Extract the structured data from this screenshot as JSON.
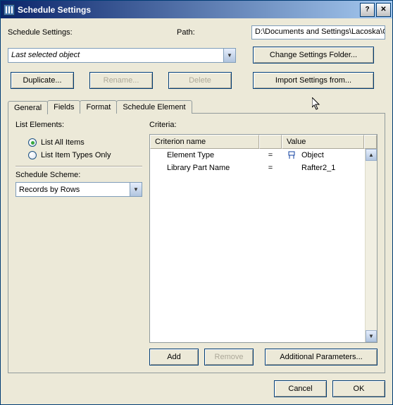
{
  "window": {
    "title": "Schedule Settings"
  },
  "header": {
    "settings_label": "Schedule Settings:",
    "path_label": "Path:",
    "path_value": "D:\\Documents and Settings\\Lacoska\\C"
  },
  "object_dropdown": {
    "value": "Last selected object"
  },
  "right_buttons": {
    "change_folder": "Change Settings Folder...",
    "import": "Import Settings from..."
  },
  "action_buttons": {
    "duplicate": "Duplicate...",
    "rename": "Rename...",
    "delete": "Delete"
  },
  "tabs": {
    "general": "General",
    "fields": "Fields",
    "format": "Format",
    "schedule_element": "Schedule Element"
  },
  "list_elements": {
    "label": "List Elements:",
    "opt_all": "List All Items",
    "opt_types": "List Item Types Only"
  },
  "schedule_scheme": {
    "label": "Schedule Scheme:",
    "value": "Records by Rows"
  },
  "criteria": {
    "label": "Criteria:",
    "col_name": "Criterion name",
    "col_value": "Value",
    "rows": [
      {
        "name": "Element Type",
        "op": "=",
        "value": "Object",
        "icon": true
      },
      {
        "name": "Library Part Name",
        "op": "=",
        "value": "Rafter2_1",
        "icon": false
      }
    ],
    "add": "Add",
    "remove": "Remove",
    "additional": "Additional Parameters..."
  },
  "dialog": {
    "cancel": "Cancel",
    "ok": "OK"
  }
}
